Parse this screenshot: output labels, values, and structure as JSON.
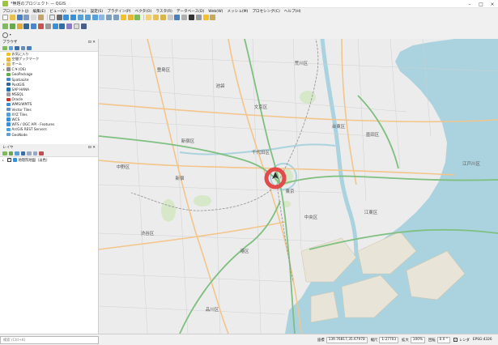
{
  "window": {
    "title": "*無題のプロジェクト — QGIS",
    "minimize_glyph": "–",
    "maximize_glyph": "□",
    "close_glyph": "×"
  },
  "menubar": [
    "プロジェクト(J)",
    "編集(E)",
    "ビュー(V)",
    "レイヤ(L)",
    "設定(S)",
    "プラグイン(P)",
    "ベクタ(O)",
    "ラスタ(R)",
    "データベース(D)",
    "Web(W)",
    "メッシュ(M)",
    "プロセシング(C)",
    "ヘルプ(H)"
  ],
  "browser": {
    "title": "ブラウザ",
    "float_label": "⊡ ✕",
    "items": [
      {
        "label": "お気に入り",
        "expander": "",
        "icon_color": "#f2c029",
        "icon": "star-icon"
      },
      {
        "label": "空間ブックマーク",
        "expander": "",
        "icon_color": "#e8b43a",
        "icon": "bookmark-icon"
      },
      {
        "label": "ホーム",
        "expander": "▸",
        "icon_color": "#e3c06a",
        "icon": "folder-icon"
      },
      {
        "label": "C:¥ (OS)",
        "expander": "▸",
        "icon_color": "#8a8a8a",
        "icon": "drive-icon"
      },
      {
        "label": "GeoPackage",
        "expander": "",
        "icon_color": "#6aa84f",
        "icon": "geopackage-icon"
      },
      {
        "label": "SpatiaLite",
        "expander": "",
        "icon_color": "#4a86c5",
        "icon": "spatialite-icon"
      },
      {
        "label": "PostGIS",
        "expander": "",
        "icon_color": "#336791",
        "icon": "postgis-icon"
      },
      {
        "label": "SAP HANA",
        "expander": "",
        "icon_color": "#1f6fb5",
        "icon": "sap-hana-icon"
      },
      {
        "label": "MSSQL",
        "expander": "",
        "icon_color": "#a0a0a0",
        "icon": "mssql-icon"
      },
      {
        "label": "Oracle",
        "expander": "",
        "icon_color": "#c0392b",
        "icon": "oracle-icon"
      },
      {
        "label": "WMS/WMTS",
        "expander": "",
        "icon_color": "#3b8fd6",
        "icon": "wms-icon"
      },
      {
        "label": "Vector Tiles",
        "expander": "",
        "icon_color": "#6c8ebf",
        "icon": "vector-tiles-icon"
      },
      {
        "label": "XYZ Tiles",
        "expander": "",
        "icon_color": "#5aa0d8",
        "icon": "xyz-tiles-icon"
      },
      {
        "label": "WCS",
        "expander": "",
        "icon_color": "#3b8fd6",
        "icon": "wcs-icon"
      },
      {
        "label": "WFS / OGC API - Features",
        "expander": "",
        "icon_color": "#3b8fd6",
        "icon": "wfs-icon"
      },
      {
        "label": "ArcGIS REST Servers",
        "expander": "",
        "icon_color": "#4aa3df",
        "icon": "arcgis-icon"
      },
      {
        "label": "GeoNode",
        "expander": "",
        "icon_color": "#6aa0c8",
        "icon": "geonode-icon"
      }
    ]
  },
  "layers": {
    "title": "レイヤ",
    "float_label": "⊡ ✕",
    "items": [
      {
        "label": "地理院地図（淡色）",
        "checked": "✓",
        "expander": "▸"
      }
    ]
  },
  "status": {
    "locator_placeholder": "検索 (Ctrl+K)",
    "coordinate_label": "座標",
    "coordinate_value": "139.76817,35.67978",
    "scale_label": "縮尺",
    "scale_value": "1:27703",
    "magnifier_label": "拡大",
    "magnifier_value": "100%",
    "rotation_label": "回転",
    "rotation_value": "0.0 °",
    "render_label": "レンダ",
    "render_checked": "✓",
    "crs_label": "EPSG:4326"
  },
  "map": {
    "places": [
      "豊島区",
      "文京区",
      "荒川区",
      "台東区",
      "新宿区",
      "中野区",
      "千代田区",
      "渋谷区",
      "港区",
      "中央区",
      "江東区",
      "墨田区",
      "品川区",
      "江戸川区",
      "東京",
      "新宿",
      "池袋"
    ],
    "marker_color": "#e34a4a",
    "water_color": "#aad3df",
    "land_color": "#ececec"
  }
}
